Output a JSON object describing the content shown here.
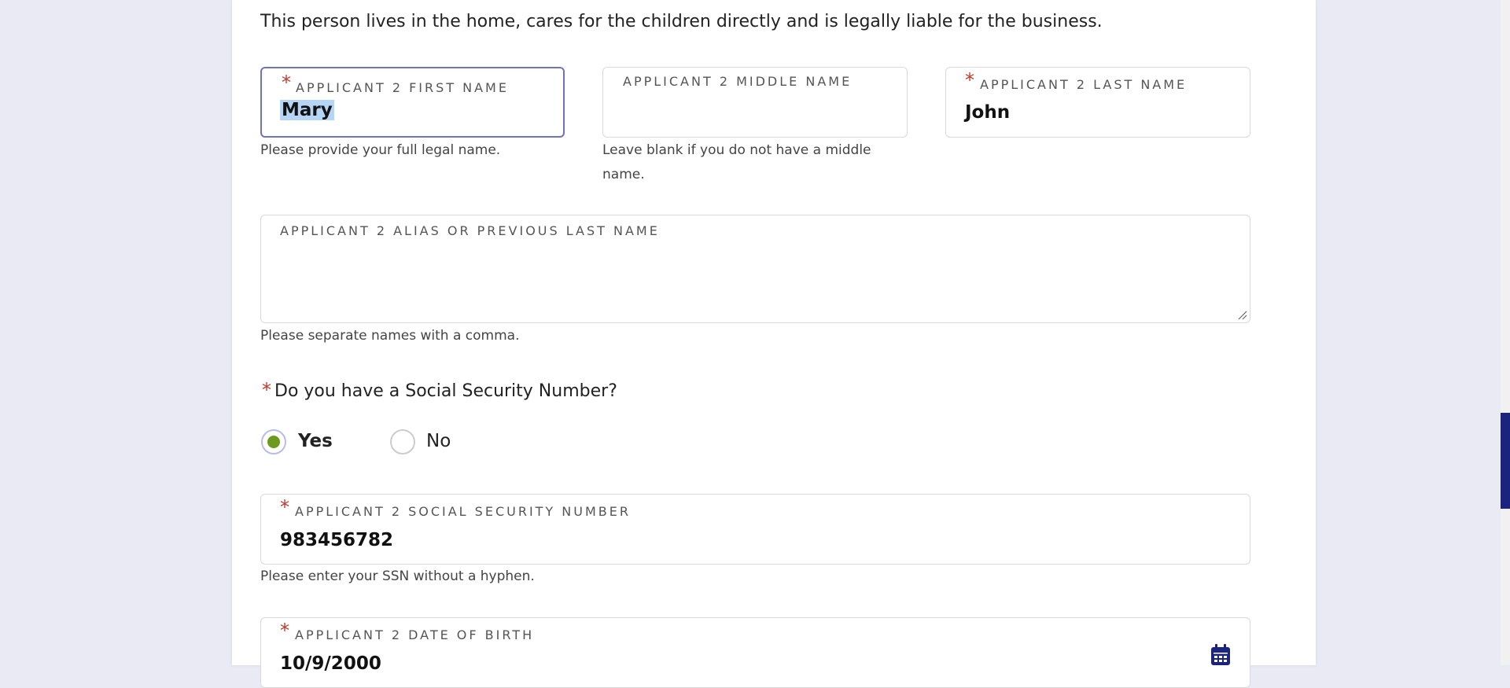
{
  "intro": "This person lives in the home, cares for the children directly and is legally liable for the business.",
  "required_marker": "*",
  "first_name": {
    "label": "APPLICANT 2 FIRST NAME",
    "value": "Mary",
    "help": "Please provide your full legal name."
  },
  "middle_name": {
    "label": "APPLICANT 2 MIDDLE NAME",
    "value": "",
    "help": "Leave blank if you do not have a middle name."
  },
  "last_name": {
    "label": "APPLICANT 2 LAST NAME",
    "value": "John"
  },
  "alias": {
    "label": "APPLICANT 2 ALIAS OR PREVIOUS LAST NAME",
    "value": "",
    "help": "Please separate names with a comma."
  },
  "ssn_question": {
    "text": "Do you have a Social Security Number?",
    "options": [
      {
        "label": "Yes",
        "selected": true
      },
      {
        "label": "No",
        "selected": false
      }
    ]
  },
  "ssn": {
    "label": "APPLICANT 2 SOCIAL SECURITY NUMBER",
    "value": "983456782",
    "help": "Please enter your SSN without a hyphen."
  },
  "dob": {
    "label": "APPLICANT 2 DATE OF BIRTH",
    "value": "10/9/2000",
    "icon": "calendar-icon"
  },
  "colors": {
    "accent": "#6b9a1c",
    "focus_border": "#6f73b8",
    "required": "#c0392b",
    "scroll_thumb": "#1a237e"
  }
}
